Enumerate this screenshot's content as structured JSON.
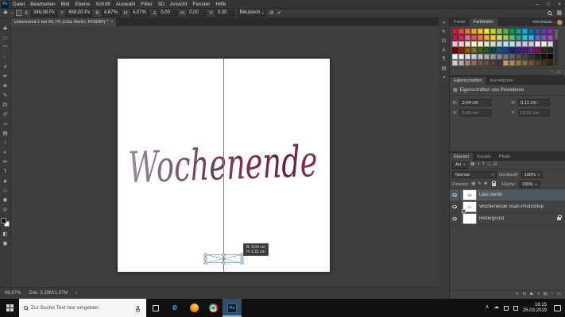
{
  "titlebar": {
    "app_glyph": "Ps",
    "menus": [
      "Datei",
      "Bearbeiten",
      "Bild",
      "Ebene",
      "Schrift",
      "Auswahl",
      "Filter",
      "3D",
      "Ansicht",
      "Fenster",
      "Hilfe"
    ],
    "minimize": "–",
    "maximize": "□",
    "close": "×"
  },
  "options_bar": {
    "tool_glyph": "✚",
    "fields": [
      {
        "name": "x-field",
        "label": "X:",
        "value": "346,08 Px"
      },
      {
        "name": "y-field",
        "label": "Y:",
        "value": "658,00 Px"
      },
      {
        "name": "width-field",
        "label": "B:",
        "value": "4,67%"
      },
      {
        "name": "height-field",
        "label": "H:",
        "value": "4,07%"
      },
      {
        "name": "angle-field",
        "label": "∠",
        "value": "0,00"
      },
      {
        "name": "h-skew-field",
        "label": "H:",
        "value": "0,00"
      },
      {
        "name": "v-skew-field",
        "label": "V:",
        "value": "0,00"
      }
    ],
    "interpolation": "Bikubisch",
    "cancel_glyph": "⊘",
    "commit_glyph": "✓"
  },
  "document_tab": {
    "title": "Unbenannt-1 bei 66,7% (Lilac Berlin, RGB/8#) *",
    "close_glyph": "×"
  },
  "tools": [
    {
      "name": "move-tool",
      "glyph": "✚"
    },
    {
      "name": "marquee-tool",
      "glyph": "□"
    },
    {
      "name": "lasso-tool",
      "glyph": "⌒"
    },
    {
      "name": "quick-selection-tool",
      "glyph": "◌"
    },
    {
      "name": "crop-tool",
      "glyph": "#"
    },
    {
      "name": "eyedropper-tool",
      "glyph": "✒"
    },
    {
      "name": "healing-brush-tool",
      "glyph": "⊕"
    },
    {
      "name": "brush-tool",
      "glyph": "✎"
    },
    {
      "name": "clone-stamp-tool",
      "glyph": "⊡"
    },
    {
      "name": "history-brush-tool",
      "glyph": "↺"
    },
    {
      "name": "eraser-tool",
      "glyph": "▱"
    },
    {
      "name": "gradient-tool",
      "glyph": "▤"
    },
    {
      "name": "blur-tool",
      "glyph": "○"
    },
    {
      "name": "dodge-tool",
      "glyph": "◐"
    },
    {
      "name": "pen-tool",
      "glyph": "✏"
    },
    {
      "name": "type-tool",
      "glyph": "T"
    },
    {
      "name": "path-selection-tool",
      "glyph": "▲"
    },
    {
      "name": "shape-tool",
      "glyph": "◇"
    },
    {
      "name": "hand-tool",
      "glyph": "◉"
    },
    {
      "name": "zoom-tool",
      "glyph": "⊙"
    }
  ],
  "toolbar_bottom": [
    {
      "name": "quick-mask-button",
      "glyph": "◧"
    },
    {
      "name": "screen-mode-button",
      "glyph": "▣"
    }
  ],
  "canvas": {
    "lettering": "Wochenende",
    "guide_color": "#ff2fd0",
    "ink_gradient": [
      "#9a8f9e",
      "#7d6680",
      "#6d3a5a",
      "#7c2f52",
      "#6b2040",
      "#7e3b5e"
    ]
  },
  "transform_overlay": {
    "line1": "B: 3,64 cm",
    "line2": "H: 0,11 cm"
  },
  "status_bar": {
    "zoom": "66,67%",
    "doc_info": "Dok: 3,38M/1,07M",
    "arrow": "›"
  },
  "dock_strip": [
    {
      "name": "collapse-panels-icon",
      "glyph": "«"
    },
    {
      "name": "brushes-panel-icon",
      "glyph": "✎"
    },
    {
      "name": "clone-source-panel-icon",
      "glyph": "⊡"
    },
    {
      "name": "character-panel-icon",
      "glyph": "A"
    },
    {
      "name": "paragraph-panel-icon",
      "glyph": "¶"
    },
    {
      "name": "libraries-panel-icon",
      "glyph": "▤"
    },
    {
      "name": "adjustments-panel-icon",
      "glyph": "◑"
    }
  ],
  "color_panel": {
    "tabs": [
      {
        "name": "tab-farbe",
        "label": "Farbe",
        "active": false
      },
      {
        "name": "tab-farbfelder",
        "label": "Farbfelder",
        "active": true
      }
    ],
    "account_label": "Weichslede...",
    "new_icon": "▫",
    "trash_icon": "▭",
    "swatches": [
      "#e8112d",
      "#f0482a",
      "#f47820",
      "#f9a11b",
      "#fdc113",
      "#fbe616",
      "#c3d820",
      "#8cc63f",
      "#46b749",
      "#00a551",
      "#00a99d",
      "#00b5e2",
      "#0072bc",
      "#3f51a3",
      "#673ab7",
      "#9c27b0",
      "#c2185b",
      "#e91e63",
      "#f06292",
      "#ef5350",
      "#ff7043",
      "#ffa726",
      "#ffca28",
      "#d4e157",
      "#9ccc65",
      "#66bb6a",
      "#26a69a",
      "#26c6da",
      "#29b6f6",
      "#5c6bc0",
      "#7e57c2",
      "#ab47bc",
      "#f8bbd0",
      "#ffcdd2",
      "#ffe0b2",
      "#fff9c4",
      "#f0f4c3",
      "#dcedc8",
      "#c8e6c9",
      "#b2dfdb",
      "#b3e5fc",
      "#bbdefb",
      "#c5cae9",
      "#d1c4e9",
      "#e1bee7",
      "#f3e5f5",
      "#efebe9",
      "#cfd8dc",
      "#7f0000",
      "#8e2802",
      "#925f00",
      "#827717",
      "#33691e",
      "#1b5e20",
      "#004d40",
      "#01579b",
      "#0d47a1",
      "#1a237e",
      "#311b92",
      "#4a148c",
      "#6a1b9a",
      "#880e4f",
      "#3e2723",
      "#212121",
      "#ffffff",
      "#eeeeee",
      "#dddddd",
      "#cccccc",
      "#bbbbbb",
      "#aaaaaa",
      "#999999",
      "#888888",
      "#777777",
      "#666666",
      "#555555",
      "#444444",
      "#333333",
      "#222222",
      "#111111",
      "#000000",
      "#d7ccc8",
      "#bcaaa4",
      "#a1887f",
      "#8d6e63",
      "#795548",
      "#6d4c41",
      "#5d4037",
      "#4e342e",
      "#c49a6c",
      "#b08d57",
      "#9c7a3c",
      "#8a6d3b",
      "#77592e",
      "#5f451f",
      "#4a3316",
      "#362508"
    ]
  },
  "properties_panel": {
    "tabs": [
      {
        "name": "tab-eigenschaften",
        "label": "Eigenschaften",
        "active": true
      },
      {
        "name": "tab-korrekturen",
        "label": "Korrekturen",
        "active": false
      }
    ],
    "header": "Eigenschaften von Pixelebene",
    "link_glyph": "∞",
    "fields": [
      {
        "name": "width-field",
        "label": "B:",
        "value": "3,64 cm",
        "dim": false
      },
      {
        "name": "height-field",
        "label": "H:",
        "value": "0,11 cm",
        "dim": false
      },
      {
        "name": "x-field",
        "label": "X:",
        "value": "5,08 cm",
        "dim": true
      },
      {
        "name": "y-field",
        "label": "Y:",
        "value": "10,92 cm",
        "dim": true
      }
    ]
  },
  "layers_panel": {
    "tabs": [
      {
        "name": "tab-ebenen",
        "label": "Ebenen",
        "active": true
      },
      {
        "name": "tab-kanaele",
        "label": "Kanäle",
        "active": false
      },
      {
        "name": "tab-pfade",
        "label": "Pfade",
        "active": false
      }
    ],
    "filter_label": "Art",
    "filter_icons": [
      {
        "name": "pixel-filter-icon",
        "glyph": "▦"
      },
      {
        "name": "adjustment-filter-icon",
        "glyph": "◑"
      },
      {
        "name": "type-filter-icon",
        "glyph": "T"
      },
      {
        "name": "shape-filter-icon",
        "glyph": "◻"
      },
      {
        "name": "smart-object-filter-icon",
        "glyph": "⊡"
      }
    ],
    "blend_mode": "Normal",
    "opacity_label": "Deckkraft:",
    "opacity_value": "100%",
    "lock_label": "Fixieren:",
    "lock_icons": [
      {
        "name": "lock-transparent-icon",
        "glyph": "▦"
      },
      {
        "name": "lock-paint-icon",
        "glyph": "✎"
      },
      {
        "name": "lock-position-icon",
        "glyph": "✚"
      }
    ],
    "fill_label": "Fläche:",
    "fill_value": "100%",
    "layers": [
      {
        "name": "Lilac Berlin",
        "selected": true,
        "thumb_text": "ω",
        "thumb_color": "#7c3054",
        "badge": false,
        "locked": false
      },
      {
        "name": "Wochenende Scan Photoshop",
        "selected": false,
        "thumb_text": "ω",
        "thumb_color": "#8a8a8a",
        "badge": true,
        "locked": false
      },
      {
        "name": "Hintergrund",
        "selected": false,
        "thumb_text": "",
        "thumb_color": "#000000",
        "badge": false,
        "locked": true
      }
    ],
    "footer_icons": [
      {
        "name": "link-layers-icon",
        "glyph": "∞"
      },
      {
        "name": "layer-effects-icon",
        "glyph": "fx"
      },
      {
        "name": "layer-mask-icon",
        "glyph": "◙"
      },
      {
        "name": "adjustment-layer-icon",
        "glyph": "◑"
      },
      {
        "name": "layer-group-icon",
        "glyph": "▤"
      },
      {
        "name": "new-layer-icon",
        "glyph": "▫"
      },
      {
        "name": "delete-layer-icon",
        "glyph": "▭"
      }
    ]
  },
  "taskbar": {
    "search_placeholder": "Zur Suche Text hier eingeben",
    "edge_label": "e",
    "ps_label": "Ps",
    "time": "16:15",
    "date": "25.03.2019"
  }
}
